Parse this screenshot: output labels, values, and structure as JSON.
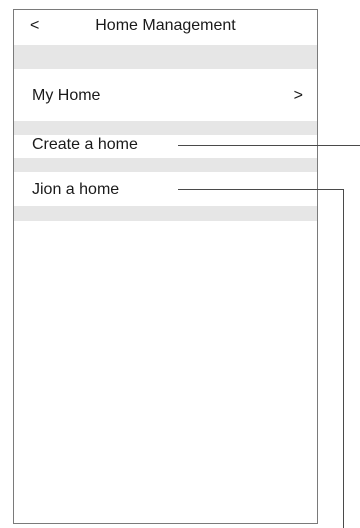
{
  "header": {
    "back_icon": "<",
    "title": "Home Management"
  },
  "my_home": {
    "label": "My Home",
    "chevron": ">"
  },
  "create_home": {
    "label": "Create a home"
  },
  "join_home": {
    "label": "Jion a home"
  }
}
